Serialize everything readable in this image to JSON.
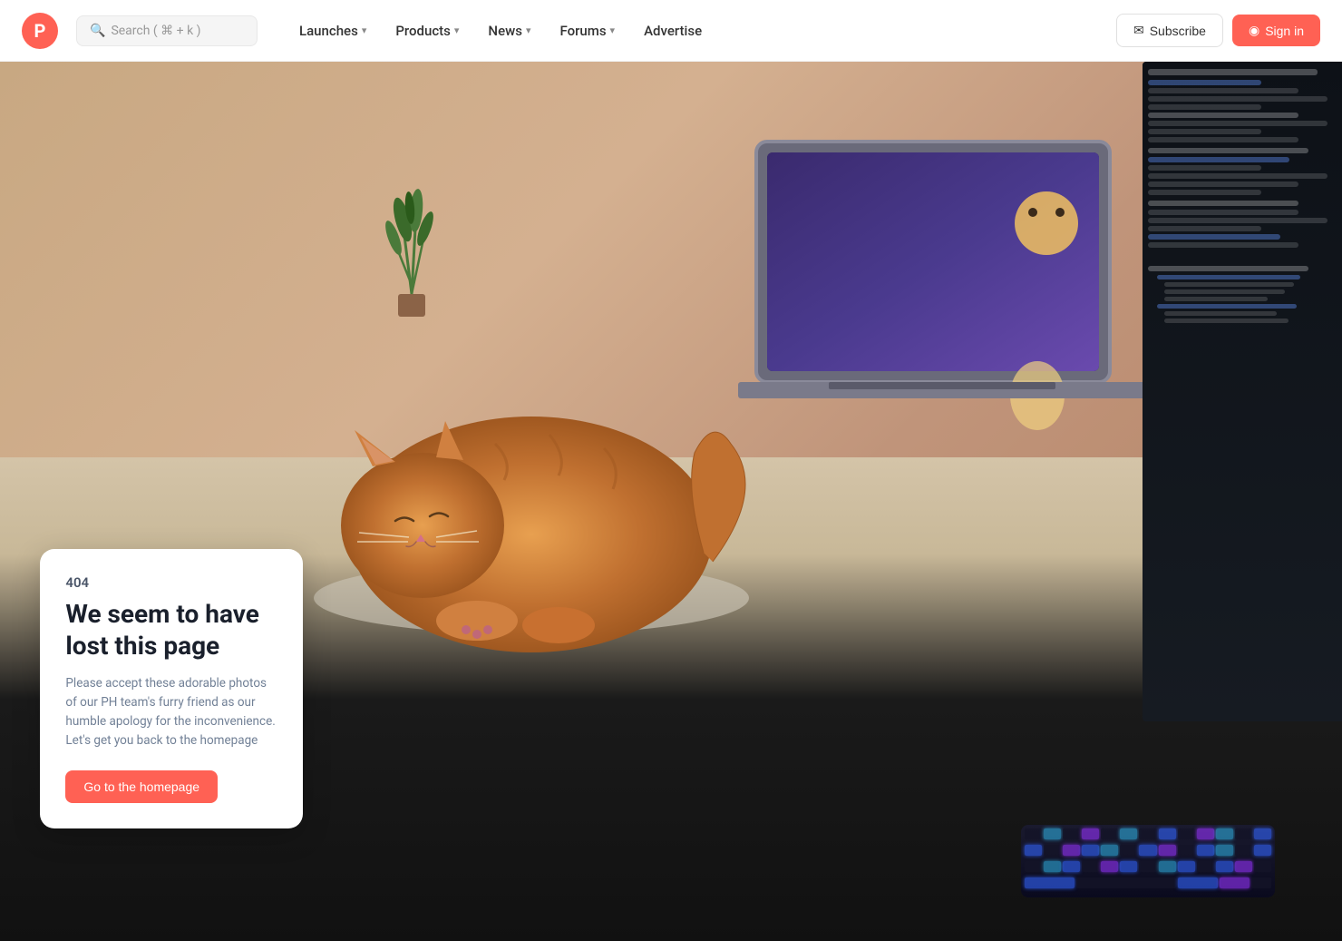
{
  "navbar": {
    "logo_letter": "P",
    "search_placeholder": "Search ( ⌘ + k )",
    "nav_items": [
      {
        "label": "Launches",
        "has_chevron": true
      },
      {
        "label": "Products",
        "has_chevron": true
      },
      {
        "label": "News",
        "has_chevron": true
      },
      {
        "label": "Forums",
        "has_chevron": true
      },
      {
        "label": "Advertise",
        "has_chevron": false
      }
    ],
    "subscribe_label": "Subscribe",
    "signin_label": "Sign in"
  },
  "error": {
    "code": "404",
    "title": "We seem to have lost this page",
    "description": "Please accept these adorable photos of our PH team's furry friend as our humble apology for the inconvenience. Let's get you back to the homepage",
    "cta_label": "Go to the homepage"
  },
  "colors": {
    "brand": "#ff6154",
    "text_dark": "#1a202c",
    "text_muted": "#718096"
  }
}
